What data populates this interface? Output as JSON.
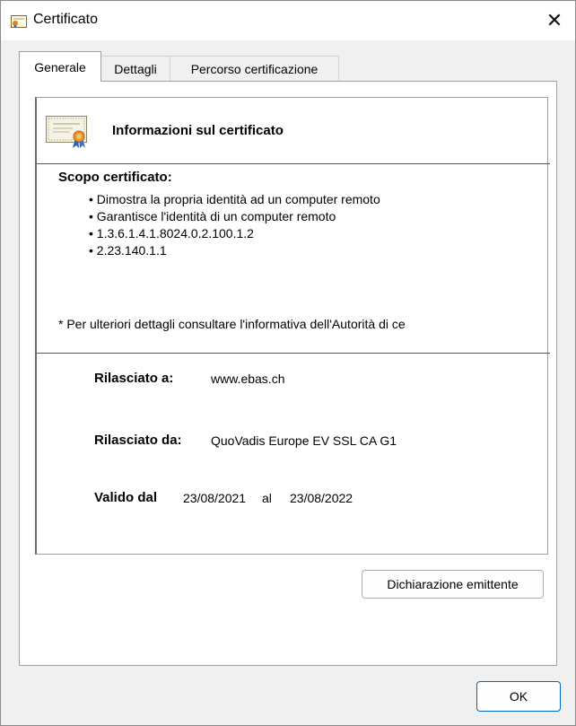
{
  "window": {
    "title": "Certificato",
    "close_glyph": "✕",
    "icon": "certificate-icon"
  },
  "tabs": [
    {
      "label": "Generale",
      "active": true
    },
    {
      "label": "Dettagli",
      "active": false
    },
    {
      "label": "Percorso certificazione",
      "active": false
    }
  ],
  "info": {
    "title": "Informazioni sul certificato",
    "scope_title": "Scopo certificato:",
    "purposes": [
      "Dimostra la propria identità ad un computer remoto",
      "Garantisce l'identità di un computer remoto",
      "1.3.6.1.4.1.8024.0.2.100.1.2",
      "2.23.140.1.1"
    ],
    "footnote": "* Per ulteriori dettagli consultare l'informativa dell'Autorità di ce"
  },
  "issued_to": {
    "label": "Rilasciato a:",
    "value": "www.ebas.ch"
  },
  "issued_by": {
    "label": "Rilasciato da:",
    "value": "QuoVadis Europe EV SSL CA G1"
  },
  "validity": {
    "label": "Valido dal",
    "from": "23/08/2021",
    "to_label": "al",
    "to": "23/08/2022"
  },
  "buttons": {
    "issuer_statement": "Dichiarazione emittente",
    "ok": "OK"
  }
}
